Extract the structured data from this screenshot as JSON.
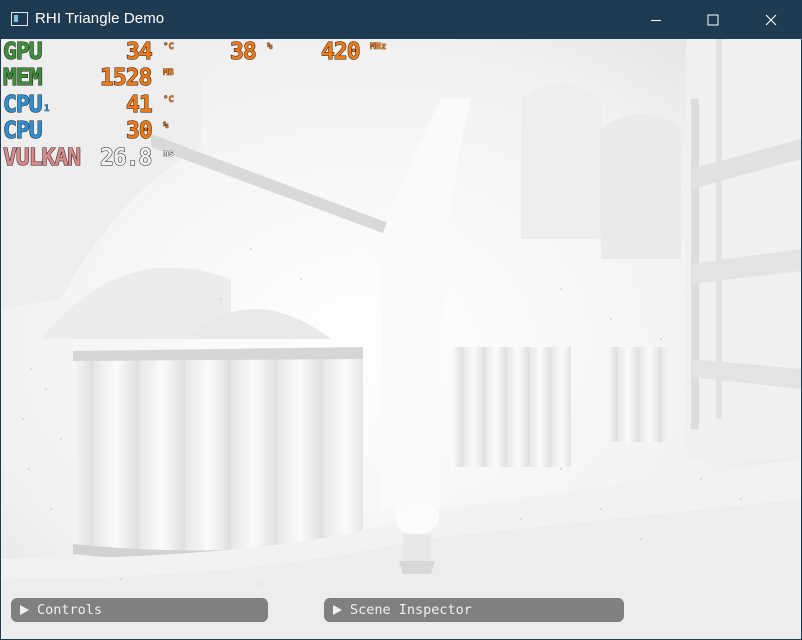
{
  "window": {
    "title": "RHI Triangle Demo",
    "icons": {
      "app": "app-window-icon",
      "minimize": "minimize-icon",
      "maximize": "maximize-icon",
      "close": "close-icon"
    }
  },
  "hud": {
    "gpu": {
      "label": "GPU",
      "temp": "34",
      "temp_unit": "°C",
      "load": "38",
      "load_unit": "%",
      "clock": "420",
      "clock_unit": "MHz"
    },
    "mem": {
      "label": "MEM",
      "value": "1528",
      "unit": "MB"
    },
    "cpu1": {
      "label": "CPU",
      "sub": "1",
      "temp": "41",
      "temp_unit": "°C"
    },
    "cpu": {
      "label": "CPU",
      "load": "30",
      "load_unit": "%"
    },
    "vulkan": {
      "label": "VULKAN",
      "frametime": "26.8",
      "unit": "ms"
    }
  },
  "panels": {
    "controls": "Controls",
    "scene_inspector": "Scene Inspector"
  },
  "colors": {
    "titlebar": "#1f3b52",
    "hud_green": "#3f8f3a",
    "hud_orange": "#f07a16",
    "hud_blue": "#2e8fd3",
    "hud_pink": "#d98989",
    "panel_button": "#808080"
  }
}
